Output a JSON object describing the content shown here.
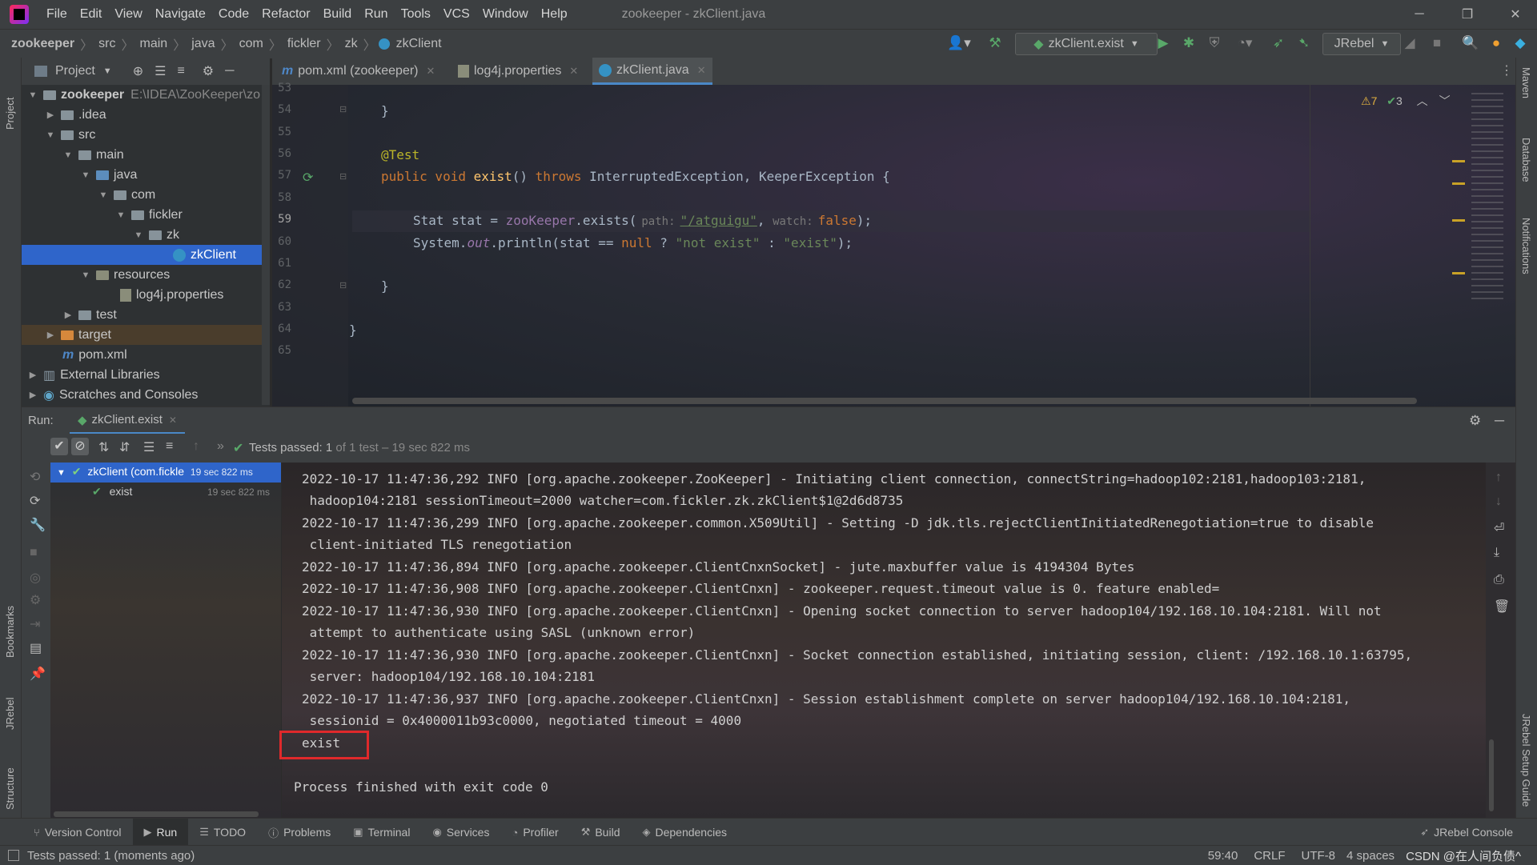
{
  "menubar": {
    "items": [
      "File",
      "Edit",
      "View",
      "Navigate",
      "Code",
      "Refactor",
      "Build",
      "Run",
      "Tools",
      "VCS",
      "Window",
      "Help"
    ],
    "title": "zookeeper - zkClient.java"
  },
  "breadcrumb": [
    "zookeeper",
    "src",
    "main",
    "java",
    "com",
    "fickler",
    "zk",
    "zkClient"
  ],
  "toolbar": {
    "run_config": "zkClient.exist",
    "jrebel": "JRebel"
  },
  "project": {
    "title": "Project",
    "tree": [
      {
        "label": "zookeeper",
        "path": "E:\\IDEA\\ZooKeeper\\zo"
      },
      {
        "label": ".idea"
      },
      {
        "label": "src"
      },
      {
        "label": "main"
      },
      {
        "label": "java"
      },
      {
        "label": "com"
      },
      {
        "label": "fickler"
      },
      {
        "label": "zk"
      },
      {
        "label": "zkClient"
      },
      {
        "label": "resources"
      },
      {
        "label": "log4j.properties"
      },
      {
        "label": "test"
      },
      {
        "label": "target"
      },
      {
        "label": "pom.xml"
      },
      {
        "label": "External Libraries"
      },
      {
        "label": "Scratches and Consoles"
      }
    ]
  },
  "editor_tabs": [
    {
      "label": "pom.xml (zookeeper)"
    },
    {
      "label": "log4j.properties"
    },
    {
      "label": "zkClient.java"
    }
  ],
  "inspections": {
    "warnings": "7",
    "ok": "3"
  },
  "editor": {
    "line_numbers": [
      "53",
      "54",
      "55",
      "56",
      "57",
      "58",
      "59",
      "60",
      "61",
      "62",
      "63",
      "64",
      "65"
    ],
    "annotation": "@Test",
    "method_sig": {
      "mods": "public void ",
      "name": "exist",
      "params": "() ",
      "throws": "throws ",
      "exceptions": "InterruptedException, KeeperException {"
    },
    "line59": {
      "type": "Stat stat = ",
      "field": "zooKeeper",
      "call": ".exists(",
      "hint_path": "path:",
      "path": "\"/atguigu\"",
      "comma": ", ",
      "hint_watch": "watch:",
      "watch": "false",
      "end": ");"
    },
    "line60": {
      "a": "System.",
      "out": "out",
      "b": ".println(stat == ",
      "null": "null",
      "c": " ? ",
      "s1": "\"not exist\"",
      "d": " : ",
      "s2": "\"exist\"",
      "e": ");"
    },
    "brace": "}"
  },
  "run": {
    "label": "Run:",
    "tab": "zkClient.exist",
    "status": "Tests passed:",
    "count": "1",
    "of": "of 1 test",
    "time": "– 19 sec 822 ms",
    "tree": [
      {
        "label": "zkClient (com.fickle",
        "time": "19 sec 822 ms"
      },
      {
        "label": "exist",
        "time": "19 sec 822 ms"
      }
    ],
    "console": [
      "2022-10-17 11:47:36,292 INFO [org.apache.zookeeper.ZooKeeper] - Initiating client connection, connectString=hadoop102:2181,hadoop103:2181,",
      " hadoop104:2181 sessionTimeout=2000 watcher=com.fickler.zk.zkClient$1@2d6d8735",
      "2022-10-17 11:47:36,299 INFO [org.apache.zookeeper.common.X509Util] - Setting -D jdk.tls.rejectClientInitiatedRenegotiation=true to disable",
      " client-initiated TLS renegotiation",
      "2022-10-17 11:47:36,894 INFO [org.apache.zookeeper.ClientCnxnSocket] - jute.maxbuffer value is 4194304 Bytes",
      "2022-10-17 11:47:36,908 INFO [org.apache.zookeeper.ClientCnxn] - zookeeper.request.timeout value is 0. feature enabled=",
      "2022-10-17 11:47:36,930 INFO [org.apache.zookeeper.ClientCnxn] - Opening socket connection to server hadoop104/192.168.10.104:2181. Will not",
      " attempt to authenticate using SASL (unknown error)",
      "2022-10-17 11:47:36,930 INFO [org.apache.zookeeper.ClientCnxn] - Socket connection established, initiating session, client: /192.168.10.1:63795,",
      " server: hadoop104/192.168.10.104:2181",
      "2022-10-17 11:47:36,937 INFO [org.apache.zookeeper.ClientCnxn] - Session establishment complete on server hadoop104/192.168.10.104:2181,",
      " sessionid = 0x4000011b93c0000, negotiated timeout = 4000",
      "exist",
      "",
      "Process finished with exit code 0"
    ]
  },
  "tool_tabs": [
    "Version Control",
    "Run",
    "TODO",
    "Problems",
    "Terminal",
    "Services",
    "Profiler",
    "Build",
    "Dependencies"
  ],
  "jrebel_console": "JRebel Console",
  "left_stripe": {
    "project": "Project",
    "bookmarks": "Bookmarks",
    "jrebel": "JRebel",
    "structure": "Structure"
  },
  "right_stripe": {
    "maven": "Maven",
    "database": "Database",
    "notifications": "Notifications",
    "jrebel_guide": "JRebel Setup Guide"
  },
  "statusbar": {
    "message": "Tests passed: 1 (moments ago)",
    "position": "59:40",
    "line_sep": "CRLF",
    "encoding": "UTF-8",
    "indent": "4 spaces",
    "watermark": "CSDN @在人间负债^"
  },
  "colors": {
    "accent": "#2f65ca",
    "highlight_box": "#e0292b",
    "run_green": "#59a869"
  }
}
